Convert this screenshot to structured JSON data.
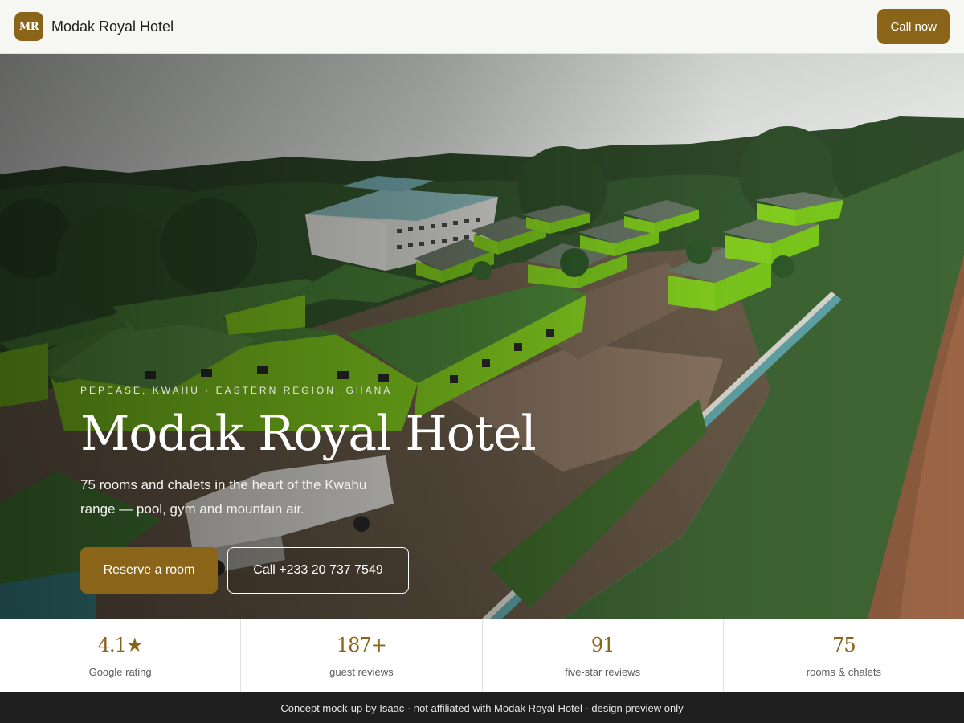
{
  "header": {
    "logo_initials": "MR",
    "brand_name": "Modak Royal Hotel",
    "call_button": "Call now"
  },
  "hero": {
    "image_icon": "aerial-hotel-photo",
    "eyebrow": "PEPEASE, KWAHU · EASTERN REGION, GHANA",
    "title": "Modak Royal Hotel",
    "subtitle": "75 rooms and chalets in the heart of the Kwahu range — pool, gym and mountain air.",
    "primary_cta": "Reserve a room",
    "secondary_cta": "Call +233 20 737 7549"
  },
  "stats": [
    {
      "value": "4.1★",
      "label": "Google rating"
    },
    {
      "value": "187+",
      "label": "guest reviews"
    },
    {
      "value": "91",
      "label": "five-star reviews"
    },
    {
      "value": "75",
      "label": "rooms & chalets"
    }
  ],
  "footer": {
    "note": "Concept mock-up by Isaac · not affiliated with Modak Royal Hotel · design preview only"
  },
  "colors": {
    "accent": "#8a6419",
    "header_bg": "#f6f6f2",
    "footer_bg": "#1f1f1f",
    "roof_green": "#3f8a34",
    "wall_lime": "#86d21f"
  }
}
